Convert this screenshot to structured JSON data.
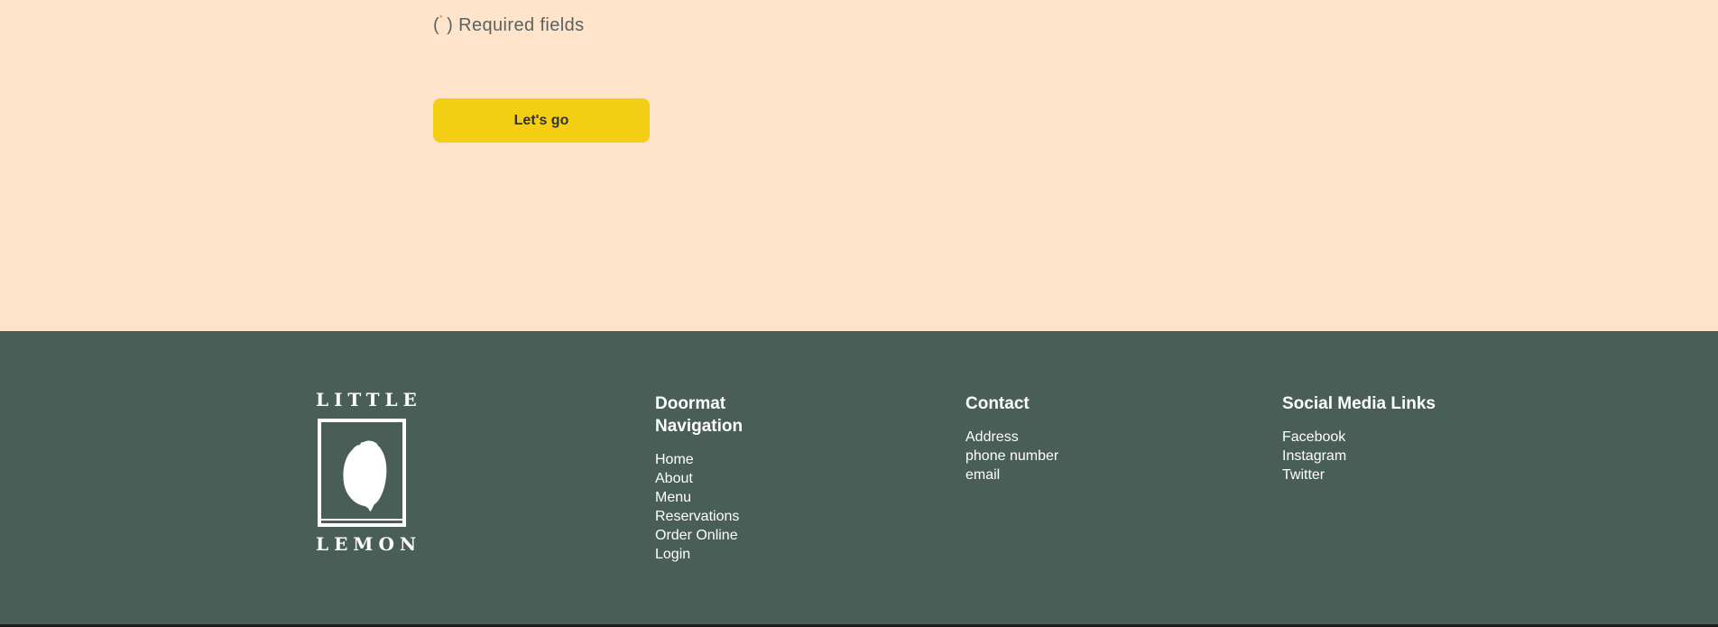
{
  "form": {
    "required_paren_open": "(",
    "required_paren_close": ")",
    "required_marker": "*",
    "required_label": "Required fields",
    "submit_label": "Let's go"
  },
  "footer": {
    "logo": {
      "top_word": "LITTLE",
      "bottom_word": "LEMON",
      "icon": "lemon-icon"
    },
    "navigation": {
      "heading": "Doormat Navigation",
      "items": [
        "Home",
        "About",
        "Menu",
        "Reservations",
        "Order Online",
        "Login"
      ]
    },
    "contact": {
      "heading": "Contact",
      "items": [
        "Address",
        "phone number",
        "email"
      ]
    },
    "social": {
      "heading": "Social Media Links",
      "items": [
        "Facebook",
        "Instagram",
        "Twitter"
      ]
    }
  },
  "colors": {
    "page_background": "#FFE4CC",
    "footer_background": "#495E57",
    "button_background": "#F4CE14",
    "required_marker": "#E8843A",
    "text_muted": "#5A6360",
    "text_light": "#FFFFFF"
  }
}
